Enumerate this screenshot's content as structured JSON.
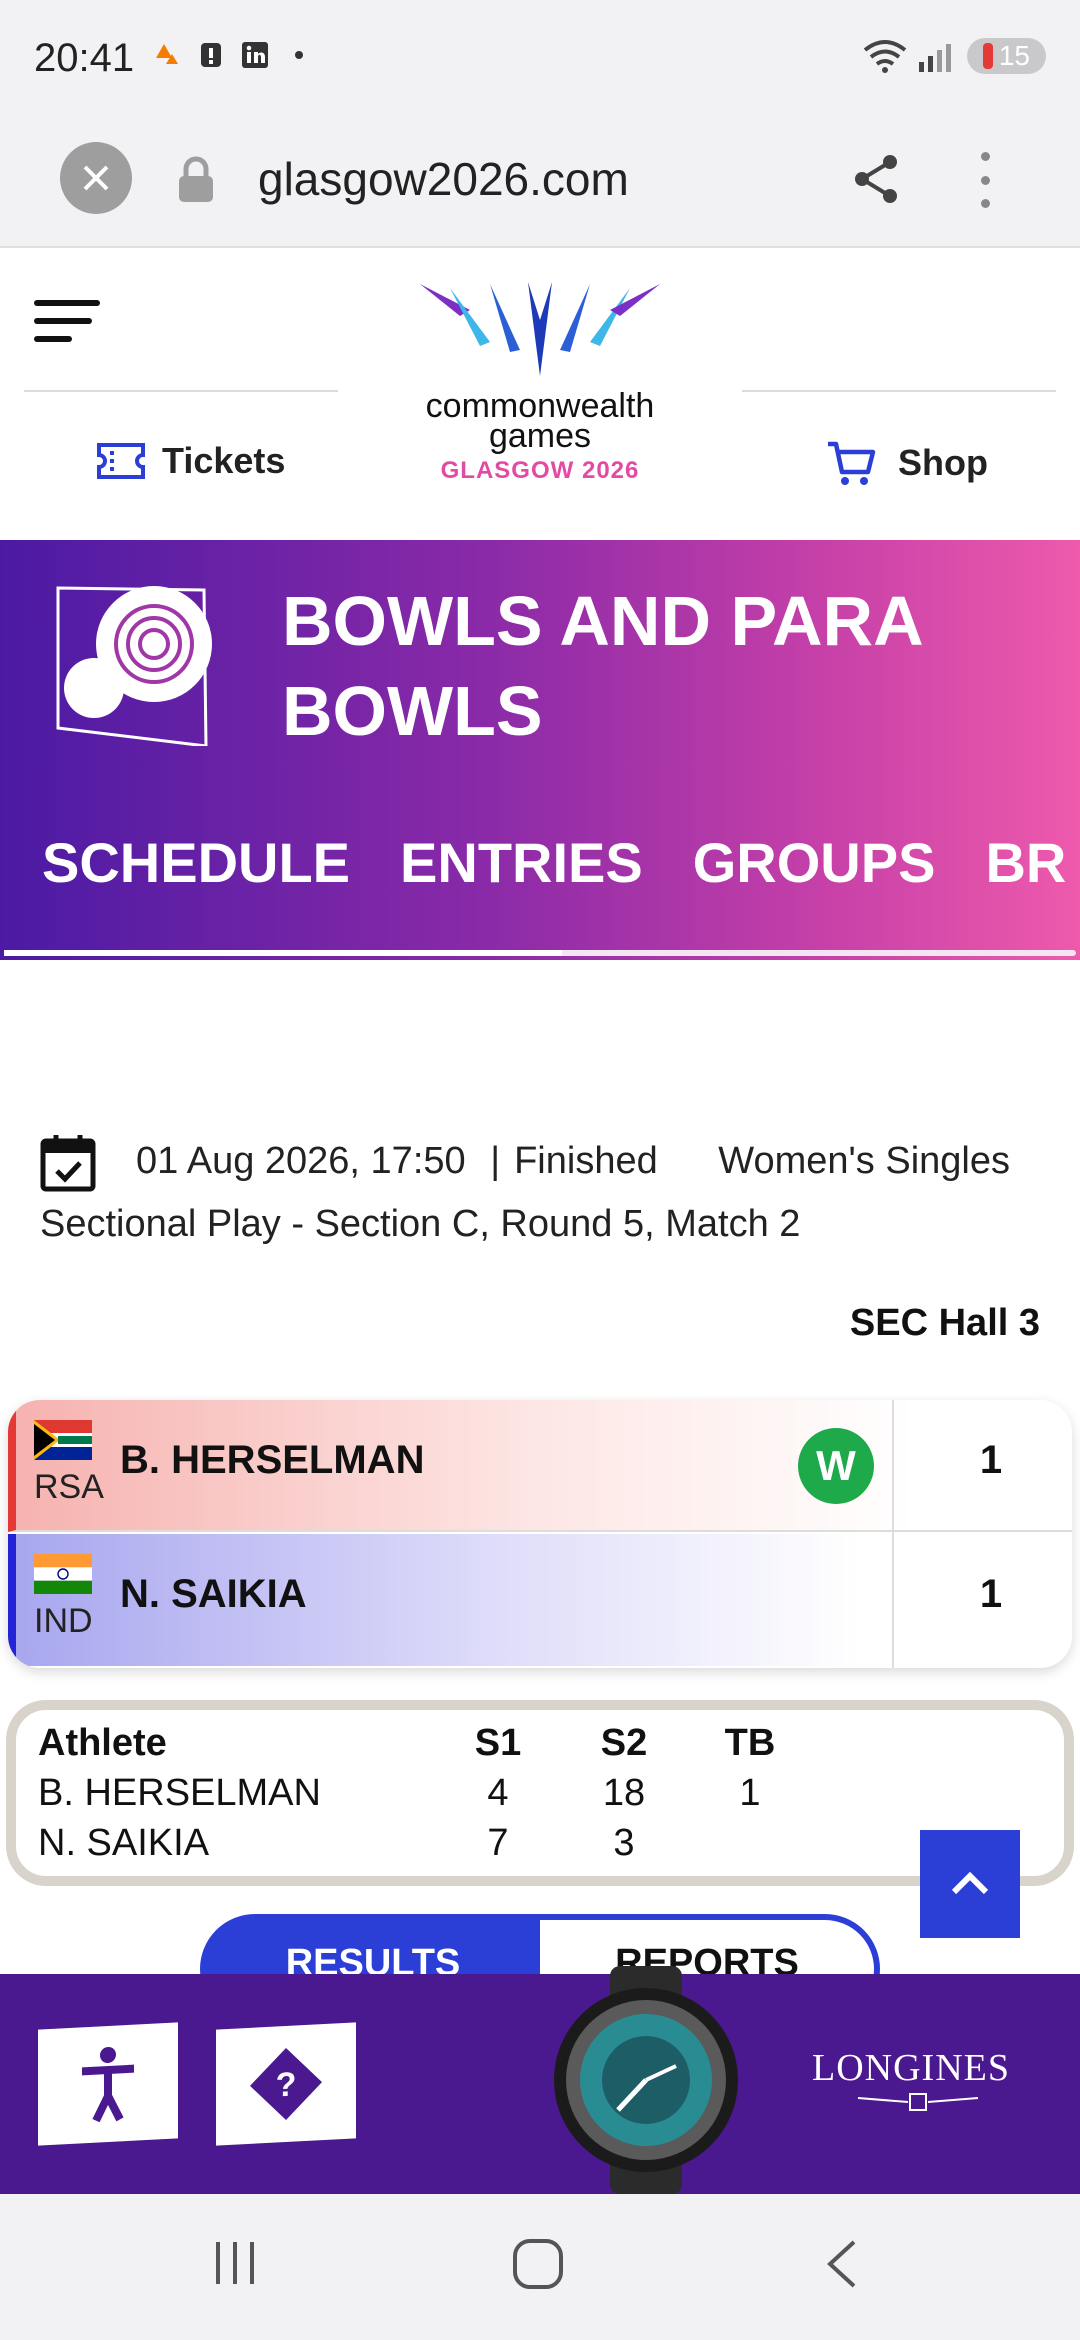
{
  "status_bar": {
    "time": "20:41",
    "battery": "15"
  },
  "browser": {
    "url": "glasgow2026.com"
  },
  "header": {
    "logo_line1": "commonwealth",
    "logo_line2": "games",
    "logo_sub": "GLASGOW 2026",
    "tickets_label": "Tickets",
    "shop_label": "Shop"
  },
  "hero": {
    "title": "BOWLS AND PARA BOWLS",
    "tabs": [
      "SCHEDULE",
      "ENTRIES",
      "GROUPS",
      "BR"
    ]
  },
  "match": {
    "datetime": "01 Aug 2026, 17:50",
    "separator": "|",
    "status": "Finished",
    "event": "Women's Singles Sectional Play - Section C, Round 5, Match 2",
    "venue": "SEC Hall 3"
  },
  "competitors": [
    {
      "code": "RSA",
      "name": "B. HERSELMAN",
      "badge": "W",
      "score": "1"
    },
    {
      "code": "IND",
      "name": "N. SAIKIA",
      "score": "1"
    }
  ],
  "ends_table": {
    "headers": [
      "Athlete",
      "S1",
      "S2",
      "TB"
    ],
    "rows": [
      [
        "B. HERSELMAN",
        "4",
        "18",
        "1"
      ],
      [
        "N. SAIKIA",
        "7",
        "3",
        ""
      ]
    ]
  },
  "switch": {
    "results": "RESULTS",
    "reports": "REPORTS"
  },
  "sponsor": {
    "brand": "LONGINES"
  },
  "colors": {
    "brand_purple": "#4a188f",
    "accent_blue": "#2b3fd6",
    "win_green": "#1eaa4b"
  }
}
